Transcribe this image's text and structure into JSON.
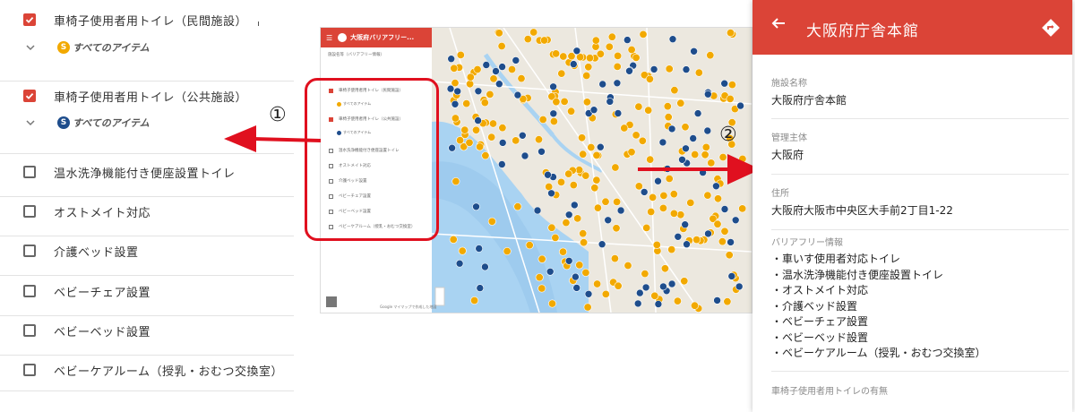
{
  "layers": [
    {
      "label": "車椅子使用者用トイレ（民間施設）",
      "checked": true,
      "sub_label": "すべてのアイテム",
      "sub_color": "#f2a900"
    },
    {
      "label": "車椅子使用者用トイレ（公共施設）",
      "checked": true,
      "sub_label": "すべてのアイテム",
      "sub_color": "#1e4d8c"
    },
    {
      "label": "温水洗浄機能付き便座設置トイレ",
      "checked": false
    },
    {
      "label": "オストメイト対応",
      "checked": false
    },
    {
      "label": "介護ベッド設置",
      "checked": false
    },
    {
      "label": "ベビーチェア設置",
      "checked": false
    },
    {
      "label": "ベビーベッド設置",
      "checked": false
    },
    {
      "label": "ベビーケアルーム（授乳・おむつ交換室）",
      "checked": false
    }
  ],
  "mini_app": {
    "title": "大阪府バリアフリー...",
    "subtitle": "施設名等（バリアフリー情報）",
    "items": [
      "車椅子使用者用トイレ（民間施設）",
      "車椅子使用者用トイレ（公共施設）",
      "温水洗浄機能付き便座設置トイレ",
      "オストメイト対応",
      "介護ベッド設置",
      "ベビーチェア設置",
      "ベビーベッド設置",
      "ベビーケアルーム（授乳・おむつ交換室）"
    ],
    "sub_label": "すべてのアイテム",
    "footer": "Google マイマップで作成した地図"
  },
  "annotations": {
    "one": "①",
    "two": "②"
  },
  "detail": {
    "title": "大阪府庁舎本館",
    "facility_name_label": "施設名称",
    "facility_name": "大阪府庁舎本館",
    "manager_label": "管理主体",
    "manager": "大阪府",
    "address_label": "住所",
    "address": "大阪府大阪市中央区大手前2丁目1-22",
    "barrier_free_label": "バリアフリー情報",
    "features": [
      "・車いす使用者対応トイレ",
      "・温水洗浄機能付き便座設置トイレ",
      "・オストメイト対応",
      "・介護ベッド設置",
      "・ベビーチェア設置",
      "・ベビーベッド設置",
      "・ベビーケアルーム（授乳・おむつ交換室）"
    ],
    "next_label": "車椅子使用者用トイレの有無"
  },
  "colors": {
    "accent": "#db4437",
    "annotation_red": "#e0101f",
    "yellow_pin": "#f2a900",
    "blue_pin": "#1e4d8c"
  }
}
